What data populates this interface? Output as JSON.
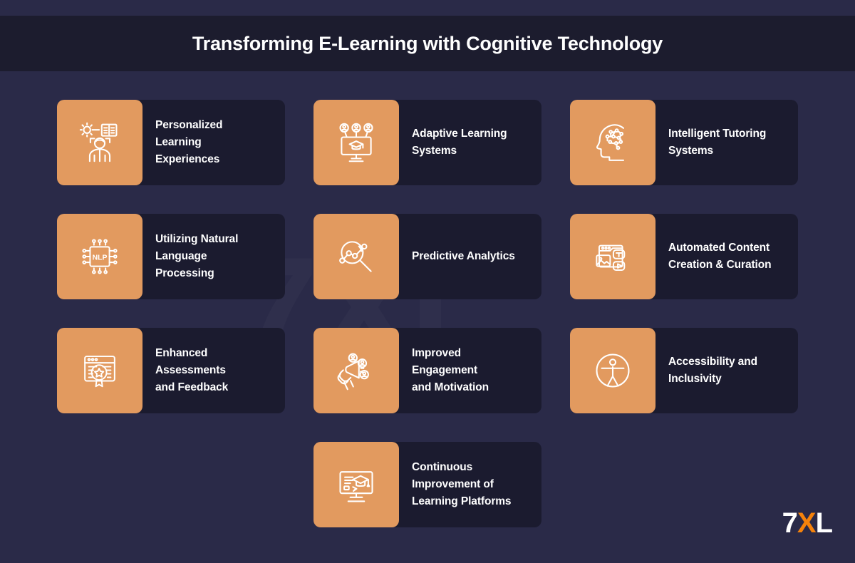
{
  "header": {
    "title": "Transforming E-Learning with Cognitive Technology"
  },
  "theme": {
    "page_background": "#2a2a48",
    "header_background": "#1c1c2e",
    "card_background": "#1b1b2f",
    "icon_tile_color": "#e29a5f",
    "text_color": "#ffffff",
    "logo_accent": "#f5820b"
  },
  "watermark": {
    "text": "7XL"
  },
  "logo": {
    "part1": "7",
    "part2": "X",
    "part3": "L"
  },
  "rows": [
    {
      "cards": [
        {
          "label": "Personalized\nLearning\nExperiences",
          "icon": "person-gear-book-icon"
        },
        {
          "label": "Adaptive Learning\nSystems",
          "icon": "monitor-graduation-users-icon"
        },
        {
          "label": "Intelligent Tutoring\nSystems",
          "icon": "head-neural-network-icon"
        }
      ]
    },
    {
      "cards": [
        {
          "label": "Utilizing Natural\nLanguage\nProcessing",
          "icon": "nlp-chip-icon"
        },
        {
          "label": "Predictive Analytics",
          "icon": "magnifier-datapoints-icon"
        },
        {
          "label": "Automated Content\nCreation & Curation",
          "icon": "browser-media-text-video-icon"
        }
      ]
    },
    {
      "cards": [
        {
          "label": "Enhanced\nAssessments\nand Feedback",
          "icon": "browser-magnifier-star-icon"
        },
        {
          "label": "Improved\nEngagement\nand Motivation",
          "icon": "megaphone-users-icon"
        },
        {
          "label": "Accessibility and\nInclusivity",
          "icon": "accessibility-person-icon"
        }
      ]
    },
    {
      "cards": [
        {
          "label": "Continuous\nImprovement of\nLearning Platforms",
          "icon": "monitor-graduation-cap-icon"
        }
      ]
    }
  ]
}
